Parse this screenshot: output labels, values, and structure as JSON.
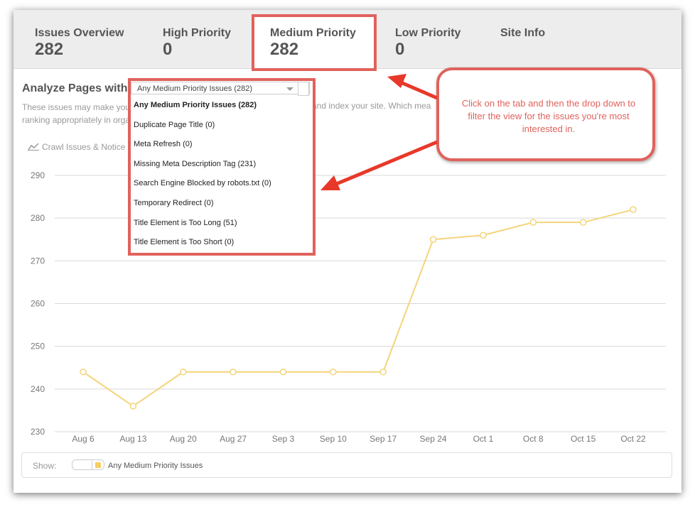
{
  "tabs": [
    {
      "label": "Issues Overview",
      "count": "282"
    },
    {
      "label": "High Priority",
      "count": "0"
    },
    {
      "label": "Medium Priority",
      "count": "282"
    },
    {
      "label": "Low Priority",
      "count": "0"
    },
    {
      "label": "Site Info",
      "count": ""
    }
  ],
  "analyze": {
    "title": "Analyze Pages with",
    "desc_line1": "These issues may make you",
    "desc_line2": "ranking appropriately in orga",
    "desc_right": "and index your site. Which mea",
    "chart_link": "Crawl Issues & Notice"
  },
  "filter": {
    "selected": "Any Medium Priority Issues (282)",
    "options": [
      "Any Medium Priority Issues (282)",
      "Duplicate Page Title (0)",
      "Meta Refresh (0)",
      "Missing Meta Description Tag (231)",
      "Search Engine Blocked by robots.txt (0)",
      "Temporary Redirect (0)",
      "Title Element is Too Long (51)",
      "Title Element is Too Short (0)"
    ]
  },
  "callout": {
    "text": "Click on the tab and then the drop down to filter the view for the issues you're most interested in."
  },
  "legend": {
    "show_label": "Show:",
    "series_label": "Any Medium Priority Issues"
  },
  "colors": {
    "series": "#f5d47a",
    "accent": "#e0625c",
    "arrow": "#e8382a"
  },
  "chart_data": {
    "type": "line",
    "categories": [
      "Aug 6",
      "Aug 13",
      "Aug 20",
      "Aug 27",
      "Sep 3",
      "Sep 10",
      "Sep 17",
      "Sep 24",
      "Oct 1",
      "Oct 8",
      "Oct 15",
      "Oct 22"
    ],
    "series": [
      {
        "name": "Any Medium Priority Issues",
        "values": [
          244,
          236,
          244,
          244,
          244,
          244,
          244,
          275,
          276,
          279,
          279,
          282
        ]
      }
    ],
    "y_ticks": [
      230,
      240,
      250,
      260,
      270,
      280,
      290
    ],
    "ylim": [
      230,
      290
    ],
    "grid": true,
    "legend": "bottom"
  }
}
